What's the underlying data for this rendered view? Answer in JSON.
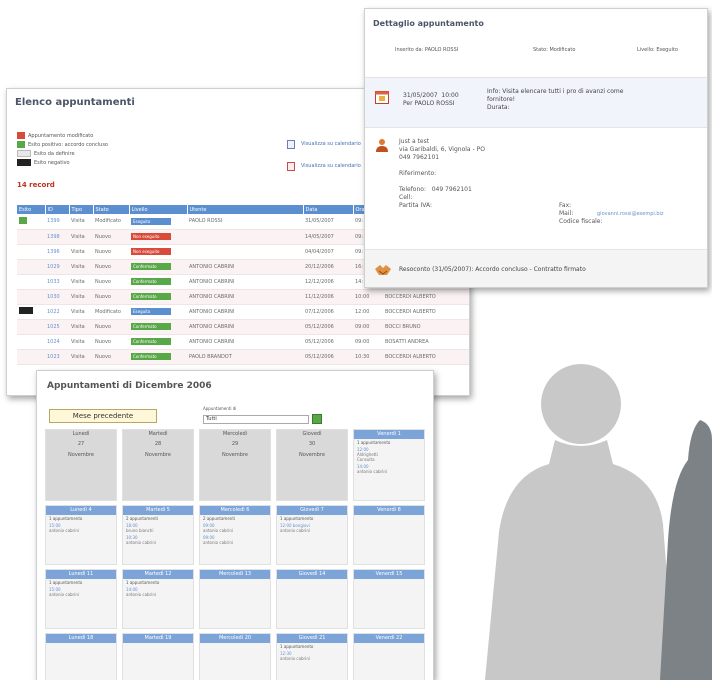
{
  "elenco": {
    "title": "Elenco appuntamenti",
    "legend": [
      {
        "label": "Appuntamento modificato",
        "color": "#d84a3a"
      },
      {
        "label": "Esito positivo: accordo concluso",
        "color": "#58a848"
      },
      {
        "label": "Esito da definire",
        "color": "#e8e8e8"
      },
      {
        "label": "Esito negativo",
        "color": "#222222"
      }
    ],
    "cal_links": [
      "Visualizza su calendario",
      "Visualizza su calendario"
    ],
    "record_count": "14 record",
    "columns": [
      "Esito",
      "ID",
      "Tipo",
      "Stato",
      "Livello",
      "Utente",
      "Data",
      "Ora"
    ],
    "rows": [
      {
        "flag": "green",
        "id": "1399",
        "tipo": "Visita",
        "stato": "Modificato",
        "livello": "Eseguito",
        "livello_class": "s-mod",
        "utente": "PAOLO ROSSI",
        "data": "31/05/2007",
        "ora": "09:"
      },
      {
        "flag": "",
        "id": "1398",
        "tipo": "Visita",
        "stato": "Nuovo",
        "livello": "Non eseguito",
        "livello_class": "s-non",
        "utente": "",
        "data": "14/05/2007",
        "ora": "09:"
      },
      {
        "flag": "",
        "id": "1396",
        "tipo": "Visita",
        "stato": "Nuovo",
        "livello": "Non eseguito",
        "livello_class": "s-non",
        "utente": "",
        "data": "04/04/2007",
        "ora": "09:"
      },
      {
        "flag": "",
        "id": "1029",
        "tipo": "Visita",
        "stato": "Nuovo",
        "livello": "Confermato",
        "livello_class": "s-acc",
        "utente": "ANTONIO CABRINI",
        "data": "20/12/2006",
        "ora": "16:"
      },
      {
        "flag": "",
        "id": "1033",
        "tipo": "Visita",
        "stato": "Nuovo",
        "livello": "Confermato",
        "livello_class": "s-acc",
        "utente": "ANTONIO CABRINI",
        "data": "12/12/2006",
        "ora": "14:"
      },
      {
        "flag": "",
        "id": "1030",
        "tipo": "Visita",
        "stato": "Nuovo",
        "livello": "Confermato",
        "livello_class": "s-acc",
        "utente": "ANTONIO CABRINI",
        "data": "11/12/2006",
        "ora": "10:00",
        "extra": "BOCCERDI ALBERTO"
      },
      {
        "flag": "neg",
        "id": "1022",
        "tipo": "Visita",
        "stato": "Modificato",
        "livello": "Eseguito",
        "livello_class": "s-mod",
        "utente": "ANTONIO CABRINI",
        "data": "07/12/2006",
        "ora": "12:00",
        "extra": "BOCCERDI ALBERTO"
      },
      {
        "flag": "",
        "id": "1025",
        "tipo": "Visita",
        "stato": "Nuovo",
        "livello": "Confermato",
        "livello_class": "s-acc",
        "utente": "ANTONIO CABRINI",
        "data": "05/12/2006",
        "ora": "09:00",
        "extra": "BOCCI BRUNO"
      },
      {
        "flag": "",
        "id": "1024",
        "tipo": "Visita",
        "stato": "Nuovo",
        "livello": "Confermato",
        "livello_class": "s-acc",
        "utente": "ANTONIO CABRINI",
        "data": "05/12/2006",
        "ora": "09:00",
        "extra": "BOSATTI ANDREA"
      },
      {
        "flag": "",
        "id": "1023",
        "tipo": "Visita",
        "stato": "Nuovo",
        "livello": "Confermato",
        "livello_class": "s-acc",
        "utente": "PAOLO BRANDOT",
        "data": "05/12/2006",
        "ora": "10:30",
        "extra": "BOCCERDI ALBERTO"
      }
    ]
  },
  "dettaglio": {
    "title": "Dettaglio appuntamento",
    "inserito": "Inserito da: PAOLO ROSSI",
    "stato": "Stato: Modificato",
    "livello": "Livello: Eseguito",
    "info_left": "31/05/2007  10:00\nPer PAOLO ROSSI",
    "info_right": "Info: Visita elencare tutti i pro di avanzi come\nfornitore!\nDurata:",
    "contact": "Just a test\nvia Garibaldi, 6, Vignola - PO\n049 7962101\n\nRiferimento:\n\nTelefono:   049 7962101\nCell:\nPartita IVA:",
    "contact_right": "Fax:\nMail:\nCodice fiscale:",
    "mail": "giovanni.rossi@esempi.biz",
    "result": "Resoconto (31/05/2007): Accordo concluso - Contratto firmato"
  },
  "calendario": {
    "title": "Appuntamenti di Dicembre 2006",
    "prev_button": "Mese precedente",
    "filter_label": "Appuntamenti di",
    "filter_value": "Tutti",
    "row1": [
      {
        "head": "Lunedì",
        "num": "27",
        "month": "Novembre"
      },
      {
        "head": "Martedì",
        "num": "28",
        "month": "Novembre"
      },
      {
        "head": "Mercoledì",
        "num": "29",
        "month": "Novembre"
      },
      {
        "head": "Giovedì",
        "num": "30",
        "month": "Novembre"
      },
      {
        "head": "Venerdì 1",
        "sub": "1 appuntamento",
        "ev": "12:00",
        "who": "Aldrighetti\nConsulta",
        "ev2": "14:00",
        "who2": "antonio cabrini"
      }
    ],
    "row2": [
      {
        "head": "Lunedì 4",
        "sub": "1 appuntamento",
        "ev": "15:00",
        "who": "antonio cabrini"
      },
      {
        "head": "Martedì 5",
        "sub": "2 appuntamenti",
        "ev": "18:00",
        "who": "bruno bianchi",
        "ev2": "10:30",
        "who2": "antonio cabrini"
      },
      {
        "head": "Mercoledì 6",
        "sub": "2 appuntamenti",
        "ev": "09:00",
        "who": "antonio cabrini",
        "ev2": "09:00",
        "who2": "antonio cabrini"
      },
      {
        "head": "Giovedì 7",
        "sub": "1 appuntamento",
        "ev": "12:00 bongiovi",
        "who": "antonio cabrini"
      },
      {
        "head": "Venerdì 8"
      }
    ],
    "row3": [
      {
        "head": "Lunedì 11",
        "sub": "1 appuntamento",
        "ev": "15:00",
        "who": "antonio cabrini"
      },
      {
        "head": "Martedì 12",
        "sub": "1 appuntamento",
        "ev": "14:00",
        "who": "antonio cabrini"
      },
      {
        "head": "Mercoledì 13"
      },
      {
        "head": "Giovedì 14"
      },
      {
        "head": "Venerdì 15"
      }
    ],
    "row4": [
      {
        "head": "Lunedì 18"
      },
      {
        "head": "Martedì 19"
      },
      {
        "head": "Mercoledì 20"
      },
      {
        "head": "Giovedì 21",
        "sub": "1 appuntamento",
        "ev": "12:30",
        "who": "antonio cabrini"
      },
      {
        "head": "Venerdì 22"
      }
    ]
  }
}
